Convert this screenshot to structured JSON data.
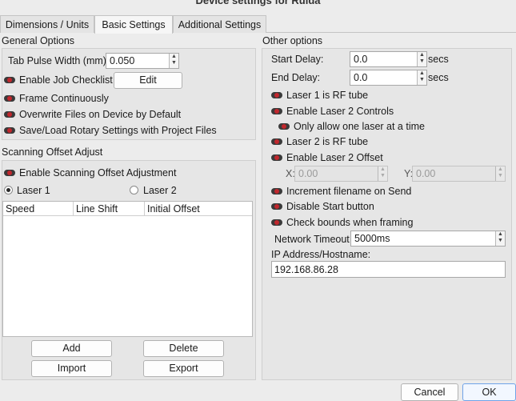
{
  "window": {
    "title": "Device settings for Ruida"
  },
  "tabs": [
    {
      "label": "Dimensions / Units"
    },
    {
      "label": "Basic Settings"
    },
    {
      "label": "Additional Settings"
    }
  ],
  "general_options": {
    "title": "General Options",
    "tab_pulse_label": "Tab Pulse Width (mm)",
    "tab_pulse_value": "0.050",
    "enable_job_checklist": "Enable Job Checklist",
    "edit_button": "Edit",
    "frame_continuously": "Frame Continuously",
    "overwrite_files": "Overwrite Files on Device by Default",
    "save_load_rotary": "Save/Load Rotary Settings with Project Files"
  },
  "scanning_offset": {
    "title": "Scanning Offset Adjust",
    "enable_label": "Enable Scanning Offset Adjustment",
    "laser1": "Laser 1",
    "laser2": "Laser 2",
    "selected_laser": "Laser 1",
    "columns": [
      "Speed",
      "Line Shift",
      "Initial Offset"
    ],
    "add_button": "Add",
    "delete_button": "Delete",
    "import_button": "Import",
    "export_button": "Export"
  },
  "other_options": {
    "title": "Other options",
    "start_delay_label": "Start Delay:",
    "start_delay_value": "0.0",
    "start_delay_unit": "secs",
    "end_delay_label": "End Delay:",
    "end_delay_value": "0.0",
    "end_delay_unit": "secs",
    "laser1_rf": "Laser 1 is RF tube",
    "enable_laser2_controls": "Enable Laser 2 Controls",
    "only_one_laser": "Only allow one laser at a time",
    "laser2_rf": "Laser 2 is RF tube",
    "enable_laser2_offset": "Enable Laser 2 Offset",
    "x_label": "X:",
    "x_value": "0.00",
    "y_label": "Y:",
    "y_value": "0.00",
    "increment_filename": "Increment filename on Send",
    "disable_start_button": "Disable Start button",
    "check_bounds": "Check bounds when framing",
    "network_timeout_label": "Network Timeout",
    "network_timeout_value": "5000ms",
    "ip_label": "IP Address/Hostname:",
    "ip_value": "192.168.86.28"
  },
  "footer": {
    "cancel": "Cancel",
    "ok": "OK"
  },
  "colors": {
    "toggle_accent": "#c1272d",
    "ok_border": "#6fa3e8"
  },
  "icons": [
    "toggle-switch-icon",
    "spin-arrows-icon",
    "dropdown-arrows-icon"
  ]
}
